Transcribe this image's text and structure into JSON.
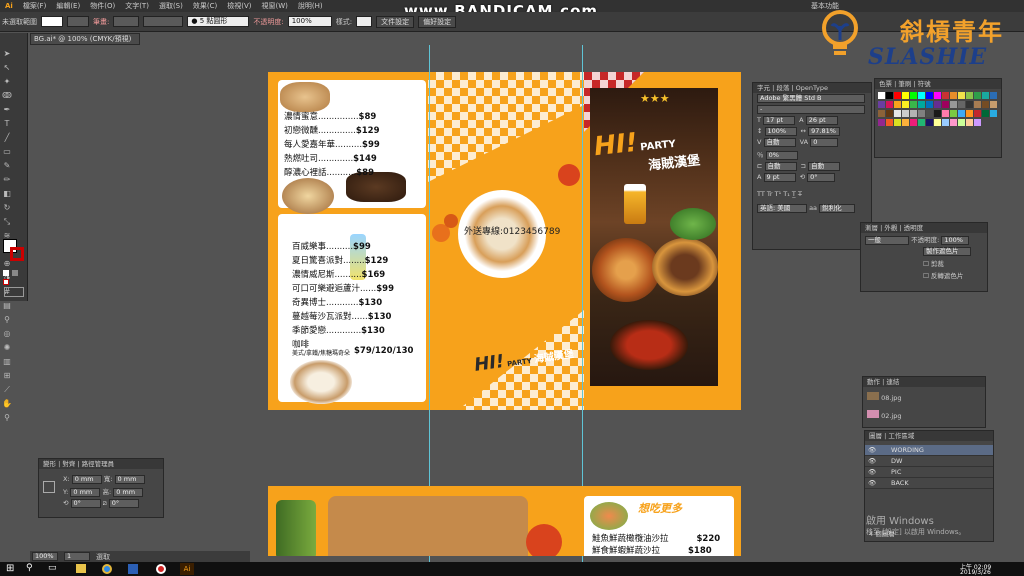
{
  "watermark": "www.BANDICAM.com",
  "brand": {
    "cn": "斜槓青年",
    "en": "SLASHIE"
  },
  "menubar": {
    "items": [
      "檔案(F)",
      "編輯(E)",
      "物件(O)",
      "文字(T)",
      "選取(S)",
      "效果(C)",
      "檢視(V)",
      "視窗(W)",
      "說明(H)"
    ],
    "workspace": "基本功能"
  },
  "control_bar": {
    "selection": "未選取範圍",
    "stroke_label": "筆畫:",
    "brush": "● 5 點圓形",
    "opacity_label": "不透明度:",
    "opacity": "100%",
    "style_label": "樣式:",
    "doc_setup": "文件設定",
    "prefs": "偏好設定"
  },
  "doc_tab": "BG.ai* @ 100% (CMYK/預視)",
  "menu_panel_1": {
    "items": [
      {
        "name": "濃情蜜意",
        "dots": "...............",
        "price": "$89"
      },
      {
        "name": "初戀微醺",
        "dots": "..............",
        "price": "$129"
      },
      {
        "name": "每人愛嘉年華",
        "dots": "..........",
        "price": "$99"
      },
      {
        "name": "熱燃吐司",
        "dots": ".............",
        "price": "$149"
      },
      {
        "name": "醇濃心裡話",
        "dots": "...........",
        "price": "$89"
      }
    ]
  },
  "menu_panel_2": {
    "items": [
      {
        "name": "百威樂事",
        "dots": "..........",
        "price": "$99"
      },
      {
        "name": "夏日驚喜派對",
        "dots": "........",
        "price": "$129"
      },
      {
        "name": "濃情威尼斯",
        "dots": "..........",
        "price": "$169"
      },
      {
        "name": "可口可樂避逅蘆汁",
        "dots": "......",
        "price": "$99"
      },
      {
        "name": "奇異博士",
        "dots": "............",
        "price": "$130"
      },
      {
        "name": "蔓越莓沙瓦派對",
        "dots": "......",
        "price": "$130"
      },
      {
        "name": "季節愛戀",
        "dots": ".............",
        "price": "$130"
      }
    ],
    "coffee_name": "咖啡",
    "coffee_sub": "美式/拿鐵/焦糖瑪奇朵",
    "coffee_price": "$79/120/130"
  },
  "center": {
    "delivery": "外送專線:0123456789",
    "logo_top": "HI!",
    "logo_small": "PARTY",
    "logo_cn": "海賊漢堡"
  },
  "poster": {
    "stars": "★★★",
    "logo_top": "HI!",
    "logo_small": "PARTY",
    "logo_cn": "海賊漢堡"
  },
  "artboard2": {
    "heading": "想吃更多",
    "items": [
      {
        "name": "鮭魚鮮蔬橄欖油沙拉",
        "price": "$220"
      },
      {
        "name": "鮮食鮮蝦鮮蔬沙拉",
        "price": "$180"
      }
    ]
  },
  "char_panel": {
    "tabs": [
      "字元",
      "段落",
      "OpenType"
    ],
    "font": "Adobe 繁黑體 Std B",
    "style": "-",
    "size": "17 pt",
    "leading": "26 pt",
    "hscale": "100%",
    "vscale": "97.81%",
    "kerning": "自動",
    "tracking": "0",
    "tsume": "0%",
    "aki_left": "自動",
    "aki_right": "自動",
    "baseline": "9 pt",
    "rotate": "0°",
    "lang": "英語: 美國",
    "aa": "銳利化"
  },
  "swatch_panel": {
    "tabs": [
      "色票",
      "筆刷",
      "符號"
    ]
  },
  "transp_panel": {
    "tabs": [
      "漸層",
      "外觀",
      "透明度"
    ],
    "mode": "一般",
    "opacity_label": "不透明度:",
    "opacity": "100%",
    "btn_mask": "製作遮色片",
    "chk_clip": "剪裁",
    "chk_invert": "反轉遮色片"
  },
  "links_panel": {
    "tabs": [
      "動作",
      "連結"
    ],
    "items": [
      "08.jpg",
      "02.jpg"
    ]
  },
  "layers_panel": {
    "tabs": [
      "圖層",
      "工作區域"
    ],
    "layers": [
      "WORDING",
      "DW",
      "PIC",
      "BACK"
    ],
    "count": "4 個圖層"
  },
  "transform_panel": {
    "tabs": [
      "變形",
      "對齊",
      "路徑管理員"
    ],
    "x": "0 mm",
    "y": "0 mm",
    "w": "0 mm",
    "h": "0 mm",
    "r1": "0°",
    "r2": "0°"
  },
  "status": {
    "zoom": "100%",
    "page": "1",
    "tool": "選取"
  },
  "windows_activate": {
    "line1": "啟用 Windows",
    "line2": "移至 [設定] 以啟用 Windows。"
  },
  "taskbar": {
    "time": "上午 02:09",
    "date": "2019/3/26"
  },
  "colors": {
    "orange": "#f7a21b",
    "brand_orange": "#f2a12b",
    "brand_blue": "#1d3f8a",
    "guide": "#5fc4d6"
  }
}
